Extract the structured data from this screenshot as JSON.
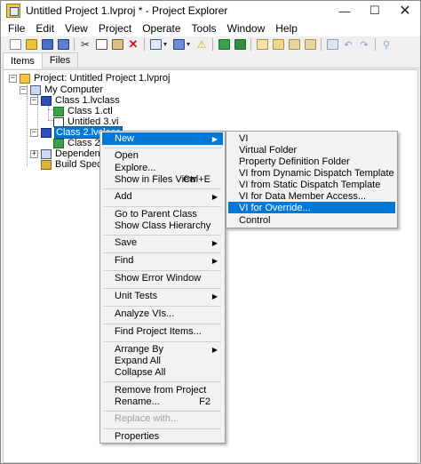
{
  "window": {
    "title": "Untitled Project 1.lvproj * - Project Explorer",
    "minimize": "—",
    "maximize": "☐",
    "close": "✕"
  },
  "menubar": [
    "File",
    "Edit",
    "View",
    "Project",
    "Operate",
    "Tools",
    "Window",
    "Help"
  ],
  "toolbar": {
    "icons": [
      "new-icon",
      "open-icon",
      "save-all-icon",
      "save-icon",
      "cut-icon",
      "copy-icon",
      "paste-icon",
      "delete-icon",
      "view-options-icon",
      "add-item-icon",
      "warning-icon",
      "add-files-icon",
      "add-folder-icon",
      "build-icon",
      "properties-icon",
      "undo-icon",
      "redo-icon",
      "find-icon"
    ]
  },
  "tabs": [
    "Items",
    "Files"
  ],
  "tree": {
    "project": "Project: Untitled Project 1.lvproj",
    "my_computer": "My Computer",
    "class1": "Class 1.lvclass",
    "class1_ctl": "Class 1.ctl",
    "untitled_vi": "Untitled 3.vi",
    "class2": "Class 2.lvclass",
    "class2_ctl": "Class 2.ctl",
    "dependencies": "Dependencies",
    "build_specs": "Build Specifications"
  },
  "context_menu": {
    "new": "New",
    "open": "Open",
    "explore": "Explore...",
    "show_in_files_view": "Show in Files View",
    "show_in_files_view_shortcut": "Ctrl+E",
    "add": "Add",
    "go_to_parent_class": "Go to Parent Class",
    "show_class_hierarchy": "Show Class Hierarchy",
    "save": "Save",
    "find": "Find",
    "show_error_window": "Show Error Window",
    "unit_tests": "Unit Tests",
    "analyze_vis": "Analyze VIs...",
    "find_project_items": "Find Project Items...",
    "arrange_by": "Arrange By",
    "expand_all": "Expand All",
    "collapse_all": "Collapse All",
    "remove_from_project": "Remove from Project",
    "rename": "Rename...",
    "rename_shortcut": "F2",
    "replace_with": "Replace with...",
    "properties": "Properties"
  },
  "submenu": {
    "vi": "VI",
    "virtual_folder": "Virtual Folder",
    "property_definition_folder": "Property Definition Folder",
    "vi_dynamic_dispatch": "VI from Dynamic Dispatch Template",
    "vi_static_dispatch": "VI from Static Dispatch Template",
    "vi_data_member_access": "VI for Data Member Access...",
    "vi_for_override": "VI for Override...",
    "control": "Control"
  },
  "colors": {
    "highlight": "#0078d7",
    "menu_bg": "#f2f2f2",
    "window_bg": "#f0f0f0"
  }
}
